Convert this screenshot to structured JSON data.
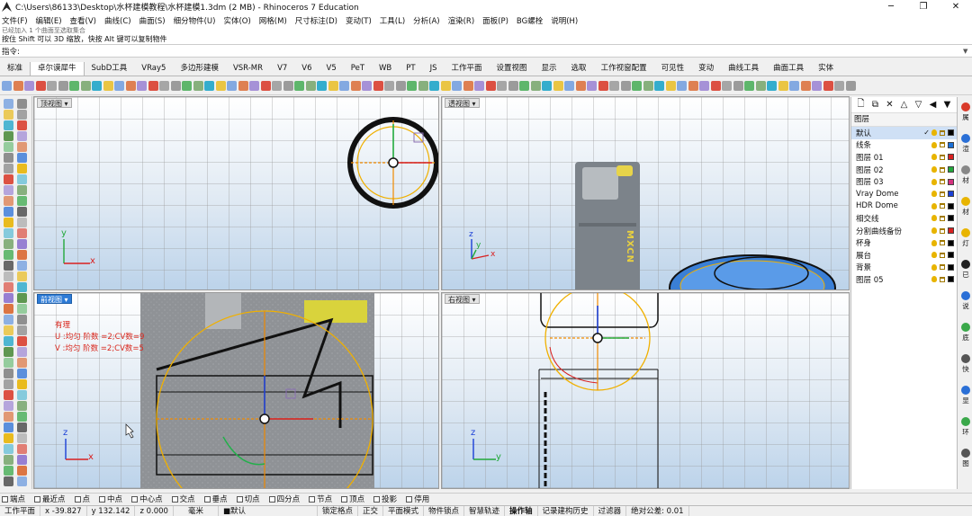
{
  "window": {
    "title": "C:\\Users\\86133\\Desktop\\水杯建模教程\\水杯建模1.3dm (2 MB) - Rhinoceros 7 Education",
    "minimize": "─",
    "maximize": "❐",
    "close": "✕"
  },
  "menu": [
    "文件(F)",
    "编辑(E)",
    "查看(V)",
    "曲线(C)",
    "曲面(S)",
    "细分物件(U)",
    "实体(O)",
    "网格(M)",
    "尺寸标注(D)",
    "变动(T)",
    "工具(L)",
    "分析(A)",
    "渲染(R)",
    "面板(P)",
    "BG螺栓",
    "说明(H)"
  ],
  "command": {
    "history": "已经加入 1 个曲面至选取集合",
    "prompt": "按住 Shift 可以 3D 缩放，快按 Alt 键可以复制物件",
    "label": "指令:",
    "value": ""
  },
  "tabs": [
    "标准",
    "卓尔谟犀牛",
    "SubD工具",
    "VRay5",
    "多边形建模",
    "VSR-MR",
    "V7",
    "V6",
    "V5",
    "PeT",
    "WB",
    "PT",
    "JS",
    "工作平面",
    "设置视图",
    "显示",
    "选取",
    "工作视窗配置",
    "可见性",
    "变动",
    "曲线工具",
    "曲面工具",
    "实体"
  ],
  "active_tab": "卓尔谟犀牛",
  "viewports": {
    "top": {
      "label": "顶视图",
      "x_axis": "x",
      "y_axis": "y"
    },
    "persp": {
      "label": "透视图",
      "x_axis": "x",
      "y_axis": "y",
      "z_axis": "z",
      "brand_text": "MXCN"
    },
    "front": {
      "label": "前视图",
      "x_axis": "x",
      "z_axis": "z",
      "annotation": [
        "有理",
        "U :均匀  阶数 =2;CV数=9",
        "V :均匀  阶数 =2;CV数=5"
      ]
    },
    "right": {
      "label": "右视图",
      "y_axis": "y",
      "z_axis": "z"
    }
  },
  "layers": {
    "toolbar": [
      "🗋",
      "⧉",
      "✕",
      "△",
      "▽",
      "◀",
      "▼"
    ],
    "header": "图层",
    "items": [
      {
        "name": "默认",
        "color": "#000000",
        "current": true,
        "check": "✓"
      },
      {
        "name": "线条",
        "color": "#1a6fd6"
      },
      {
        "name": "图层 01",
        "color": "#d92020"
      },
      {
        "name": "图层 02",
        "color": "#22a83a"
      },
      {
        "name": "图层 03",
        "color": "#d4317e"
      },
      {
        "name": "Vray Dome",
        "color": "#1a3fd6"
      },
      {
        "name": "HDR Dome",
        "color": "#000000"
      },
      {
        "name": "相交线",
        "color": "#000000"
      },
      {
        "name": "分割曲线备份",
        "color": "#d92020"
      },
      {
        "name": "杯身",
        "color": "#000000"
      },
      {
        "name": "展台",
        "color": "#000000"
      },
      {
        "name": "背景",
        "color": "#000000"
      },
      {
        "name": "图层 05",
        "color": "#000000"
      }
    ]
  },
  "side_tabs": [
    "属",
    "渲",
    "材",
    "材",
    "灯",
    "已",
    "说",
    "底",
    "快",
    "显",
    "环",
    "图"
  ],
  "osnap": [
    "端点",
    "最近点",
    "点",
    "中点",
    "中心点",
    "交点",
    "垂点",
    "切点",
    "四分点",
    "节点",
    "顶点",
    "投影",
    "停用"
  ],
  "status": {
    "plane": "工作平面",
    "x": "x -39.827",
    "y": "y 132.142",
    "z": "z 0.000",
    "unit": "毫米",
    "layer": "■默认",
    "toggles": [
      "锁定格点",
      "正交",
      "平面模式",
      "物件锁点",
      "智慧轨迹",
      "操作轴",
      "记录建构历史",
      "过滤器"
    ],
    "tolerance": "绝对公差: 0.01"
  }
}
